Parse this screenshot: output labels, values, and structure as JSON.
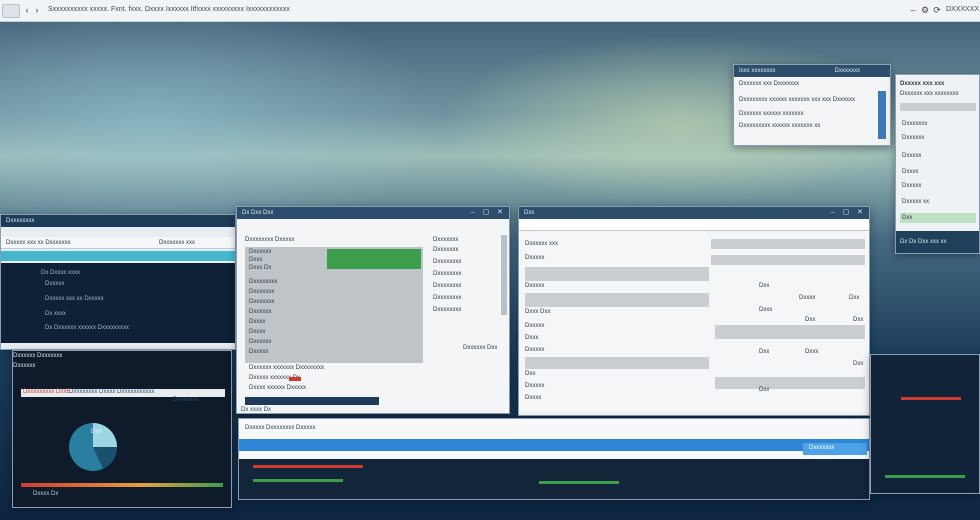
{
  "top_bar": {
    "address": "Sxxxxxxxxxx xxxxx. Fxnt. fxxx. Dxxxx Ixxxxxx Itfxxxx xxxxxxxxx Ixxxxxxxxxxxx",
    "right_label": "DXXXXXX"
  },
  "windows": {
    "top_right": {
      "title": "Ixxx xxxxxxxx",
      "title_right": "Dxxxxxxx",
      "lines": [
        "Dxxxxxx xxx Dxxxxxxx",
        "Dxxxxxxxx xxxxxx xxxxxxx xxx xxx Dxxxxxx",
        "Dxxxxxx xxxxxx xxxxxxx",
        "Dxxxxxxxxx xxxxxx xxxxxxx xx"
      ]
    },
    "far_right": {
      "title": "Dxxxxx xxx xxx",
      "subtitle": "Dxxxxxx xxx xxxxxxxx",
      "labels": [
        "Dxxxxxxx",
        "Dxxxxxx",
        "Dxxxxx",
        "Dxxxx",
        "Dxxxxx",
        "Dxxxxx xx",
        "Dxx"
      ],
      "bottom_text": "Dx Dx Dxx xxx xx"
    },
    "left": {
      "title": "Dxxxxxxxx",
      "toolbar": "Dxxxxx xxx xx Dxxxxxxx",
      "toolbar_right": "Dxxxxxxx xxx",
      "rows": [
        "Dx Dxxxx xxxx",
        "Dxxxxx",
        "Dxxxxx xxx xx Dxxxxx",
        "Dx xxxx",
        "Dx Dxxxxxx xxxxxx Dxxxxxxxxx"
      ]
    },
    "center_left": {
      "title": "Dx Dxx Dxx",
      "header": "Dxxxxxxxx Dxxxxx",
      "green_rows": [
        "Dxxxxxx",
        "Dxxx",
        "Dxxx Dx"
      ],
      "list": [
        "Dxxxxxxxx",
        "Dxxxxxxx",
        "Dxxxxxxx",
        "Dxxxxxx",
        "Dxxxx",
        "Dxxxx",
        "Dxxxxxx",
        "Dxxxxx"
      ],
      "side_list": [
        "Dxxxxxxx",
        "Dxxxxxxx",
        "Dxxxxxxxx",
        "Dxxxxxxxx",
        "Dxxxxxxxx",
        "Dxxxxxxxx",
        "Dxxxxxxxx"
      ],
      "bottom_rows": [
        "Dxxxxxx xxxxxxx Dxxxxxxxx",
        "Dxxxxx xxxxxxx Dx",
        "Dxxxx xxxxxx Dxxxxx"
      ],
      "button": "Dxxxxxx Dxx",
      "footer": "Dx xxxx Dx"
    },
    "center": {
      "title": "Dxx",
      "header": "Dxxxxxx xxx",
      "left_labels": [
        "Dxxxxx",
        "Dxxxxx",
        "Dxxx Dxx",
        "Dxxxxx",
        "Dxxx",
        "Dxxxxx",
        "Dxx",
        "Dxxxxx",
        "Dxxxx",
        "Dxxx",
        "Dxxxxx"
      ],
      "values": [
        "Dxx",
        "Dxxxx",
        "Dxx",
        "Dxxx",
        "Dxx",
        "Dxx",
        "Dxx",
        "Dxxx",
        "Dxx",
        "Dxx"
      ]
    },
    "bottom_left": {
      "title": "Dxxxxxx Dxxxxxxx",
      "subtitle": "Dxxxxxx",
      "header_a": "Dxxxxxxxxx DxxE",
      "header_b": "Dxxxxxxxx Dxxxx",
      "header_c": "Dxxxxxxxxxxx",
      "header_d": "Dxxxxxxx",
      "pie_label": "Dxx",
      "footer": "Dxxxx Dx"
    },
    "bottom_center": {
      "title": "Dxxxxx Dxxxxxxxx Dxxxxx",
      "tab": "Dxxxxxxx"
    }
  },
  "colors": {
    "accent_blue": "#2d86d6",
    "green": "#3c9d4a",
    "red": "#d13a2e",
    "dark_panel": "#0f2136"
  },
  "icons": [
    "menu-icon",
    "back-icon",
    "forward-icon",
    "refresh-icon",
    "settings-icon",
    "close-icon",
    "minimize-icon"
  ]
}
